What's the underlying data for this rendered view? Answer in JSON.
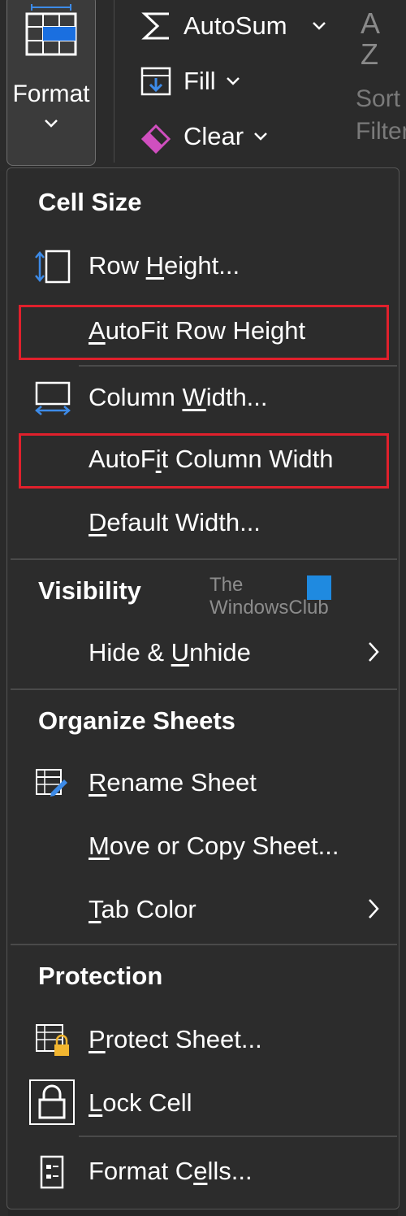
{
  "ribbon": {
    "format_label": "Format",
    "autosum_label": "AutoSum",
    "fill_label": "Fill",
    "clear_label": "Clear",
    "sort_line1": "Sort",
    "sort_line2": "Filter"
  },
  "menu": {
    "sections": {
      "cell_size": "Cell Size",
      "visibility": "Visibility",
      "organize": "Organize Sheets",
      "protection": "Protection"
    },
    "items": {
      "row_height": {
        "pre": "Row ",
        "u": "H",
        "post": "eight..."
      },
      "autofit_row": {
        "pre": "",
        "u": "A",
        "post": "utoFit Row Height"
      },
      "column_width": {
        "pre": "Column ",
        "u": "W",
        "post": "idth..."
      },
      "autofit_column": {
        "pre": "AutoF",
        "u": "i",
        "post": "t Column Width"
      },
      "default_width": {
        "pre": "",
        "u": "D",
        "post": "efault Width..."
      },
      "hide_unhide": {
        "pre": "Hide & ",
        "u": "U",
        "post": "nhide"
      },
      "rename_sheet": {
        "pre": "",
        "u": "R",
        "post": "ename Sheet"
      },
      "move_copy": {
        "pre": "",
        "u": "M",
        "post": "ove or Copy Sheet..."
      },
      "tab_color": {
        "pre": "",
        "u": "T",
        "post": "ab Color"
      },
      "protect_sheet": {
        "pre": "",
        "u": "P",
        "post": "rotect Sheet..."
      },
      "lock_cell": {
        "pre": "",
        "u": "L",
        "post": "ock Cell"
      },
      "format_cells": {
        "pre": "Format C",
        "u": "e",
        "post": "lls..."
      }
    }
  },
  "watermark": {
    "line1": "The",
    "line2": "WindowsClub"
  },
  "colors": {
    "highlight": "#e0202c",
    "menu_bg": "#2c2c2c",
    "ribbon_bg": "#2b2b2b",
    "accent_blue": "#1f8ae0"
  }
}
